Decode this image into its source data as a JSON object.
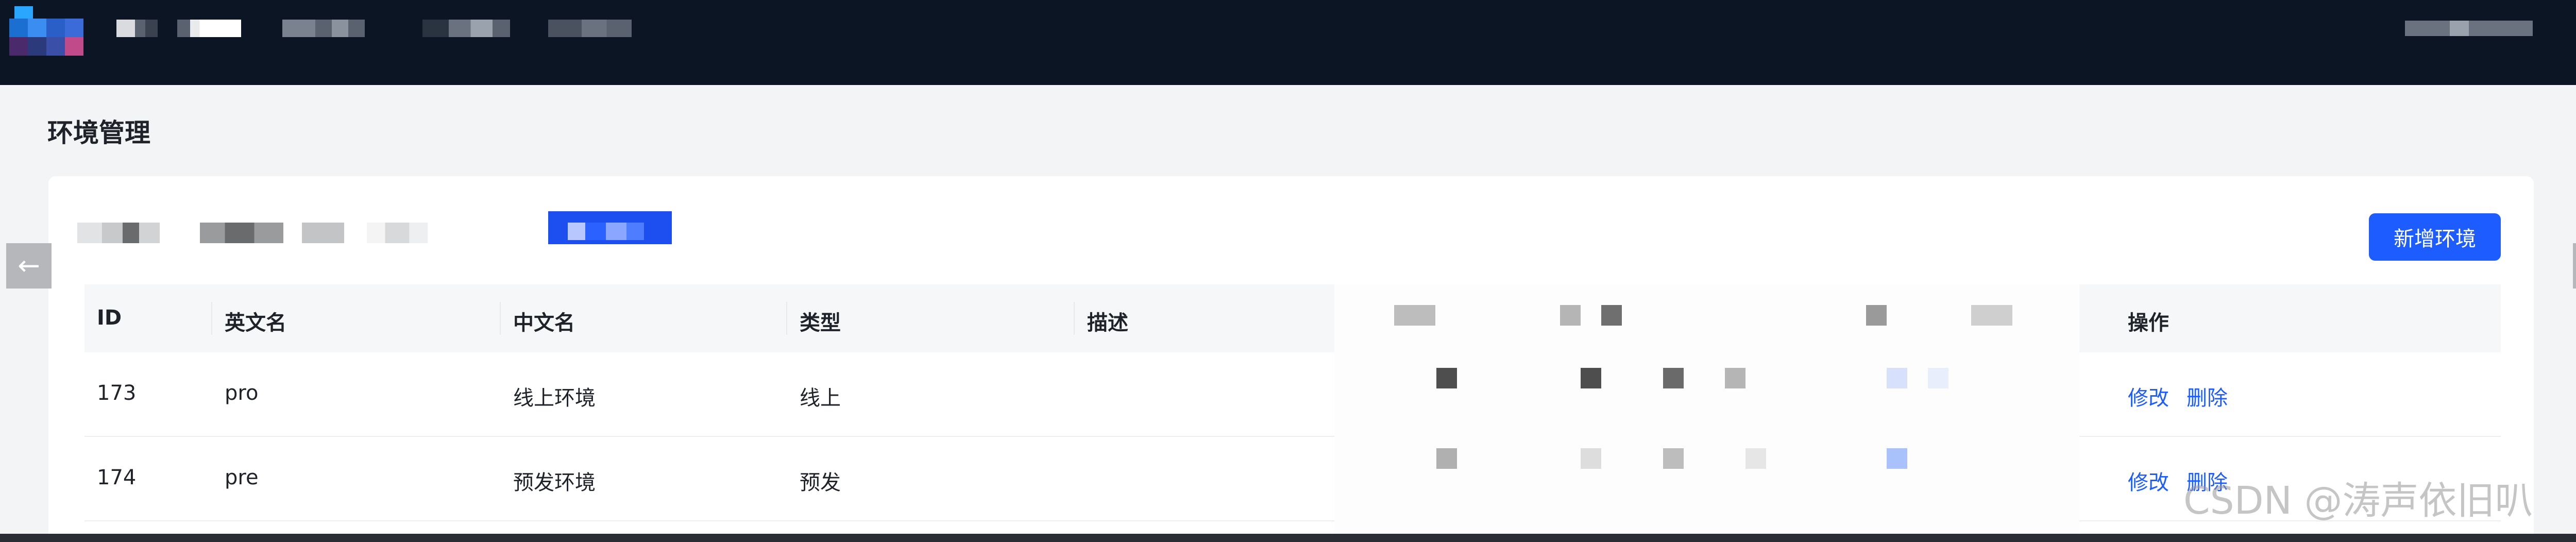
{
  "page": {
    "title": "环境管理"
  },
  "toolbar": {
    "add_label": "新增环境"
  },
  "table": {
    "columns": [
      "ID",
      "英文名",
      "中文名",
      "类型",
      "描述",
      "操作"
    ],
    "rows": [
      {
        "id": "173",
        "name_en": "pro",
        "name_cn": "线上环境",
        "type": "线上",
        "desc": "",
        "actions": [
          "修改",
          "删除"
        ]
      },
      {
        "id": "174",
        "name_en": "pre",
        "name_cn": "预发环境",
        "type": "预发",
        "desc": "",
        "actions": [
          "修改",
          "删除"
        ]
      }
    ]
  },
  "nav": {
    "prev_icon": "arrow-left-icon",
    "next_icon": "arrow-right-icon"
  },
  "watermark": "CSDN @涛声依旧叭",
  "colors": {
    "topbar": "#0b1524",
    "primary": "#1d5cff",
    "link": "#1d5cff",
    "page_bg": "#f3f4f6"
  }
}
